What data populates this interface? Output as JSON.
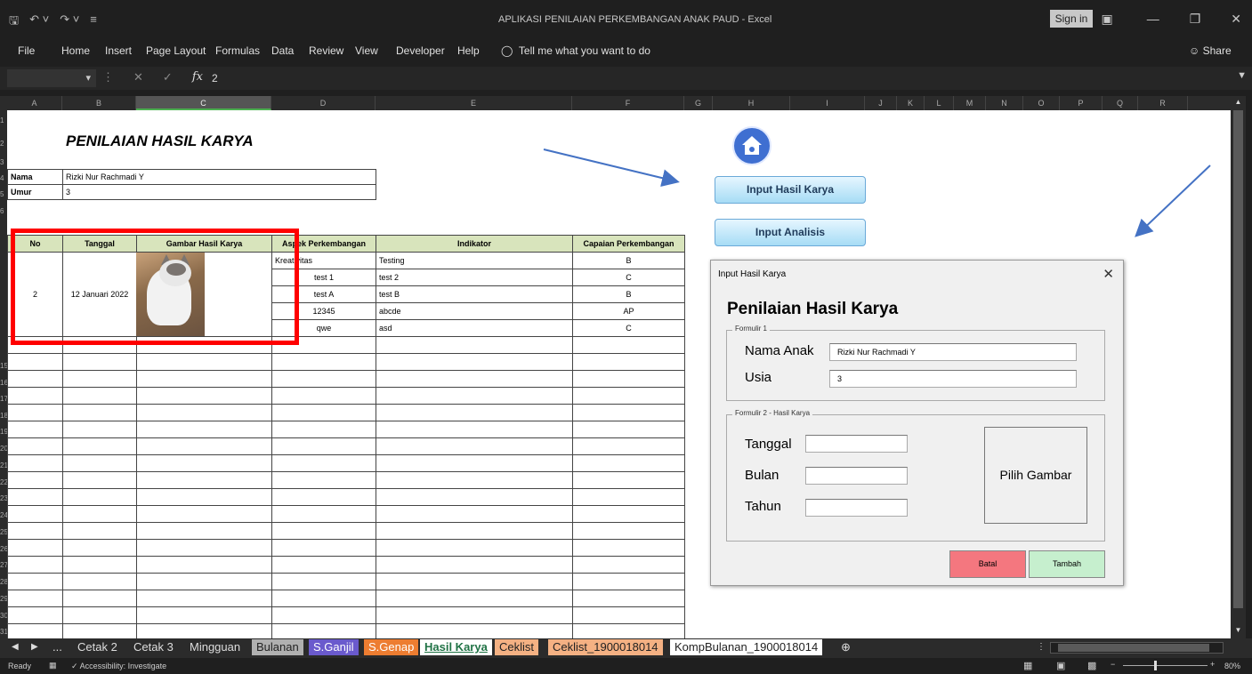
{
  "window": {
    "title": "APLIKASI PENILAIAN PERKEMBANGAN ANAK PAUD  -  Excel",
    "signin": "Sign in"
  },
  "ribbon": {
    "tabs": [
      "File",
      "Home",
      "Insert",
      "Page Layout",
      "Formulas",
      "Data",
      "Review",
      "View",
      "Developer",
      "Help"
    ],
    "tell_me": "Tell me what you want to do",
    "share": "Share"
  },
  "formula_bar": {
    "value": "2"
  },
  "columns": [
    "A",
    "B",
    "C",
    "D",
    "E",
    "F",
    "G",
    "H",
    "I",
    "J",
    "K",
    "L",
    "M",
    "N",
    "O",
    "P",
    "Q",
    "R"
  ],
  "rows": [
    "1",
    "2",
    "3",
    "4",
    "5",
    "6",
    "",
    "",
    "",
    "",
    "",
    "",
    "",
    "",
    "15",
    "16",
    "17",
    "18",
    "19",
    "20",
    "21",
    "22",
    "23",
    "24",
    "25",
    "26",
    "27",
    "28",
    "29",
    "30",
    "31"
  ],
  "sheet": {
    "title": "PENILAIAN HASIL KARYA",
    "nama_label": "Nama",
    "nama_value": "Rizki Nur Rachmadi Y",
    "umur_label": "Umur",
    "umur_value": "3",
    "headers": [
      "No",
      "Tanggal",
      "Gambar Hasil Karya",
      "Aspek Perkembangan",
      "Indikator",
      "Capaian Perkembangan"
    ],
    "no": "2",
    "tanggal": "12 Januari 2022",
    "entries": [
      {
        "aspek": "Kreativitas",
        "indikator": "Testing",
        "capaian": "B"
      },
      {
        "aspek": "test 1",
        "indikator": "test 2",
        "capaian": "C"
      },
      {
        "aspek": "test A",
        "indikator": "test B",
        "capaian": "B"
      },
      {
        "aspek": "12345",
        "indikator": "abcde",
        "capaian": "AP"
      },
      {
        "aspek": "qwe",
        "indikator": "asd",
        "capaian": "C"
      }
    ]
  },
  "buttons": {
    "input_hasil_karya": "Input Hasil Karya",
    "input_analisis": "Input Analisis"
  },
  "dialog": {
    "title": "Input Hasil Karya",
    "heading": "Penilaian Hasil Karya",
    "group1": "Formulir 1",
    "nama_anak_label": "Nama Anak",
    "nama_anak_value": "Rizki Nur Rachmadi Y",
    "usia_label": "Usia",
    "usia_value": "3",
    "group2": "Formulir 2 - Hasil Karya",
    "tanggal_label": "Tanggal",
    "bulan_label": "Bulan",
    "tahun_label": "Tahun",
    "pilih_gambar": "Pilih Gambar",
    "batal": "Batal",
    "tambah": "Tambah",
    "batal_color": "#f4777f",
    "tambah_color": "#c6efce"
  },
  "sheet_tabs": [
    {
      "label": "Cetak 2",
      "color": ""
    },
    {
      "label": "Cetak 3",
      "color": ""
    },
    {
      "label": "Mingguan",
      "color": ""
    },
    {
      "label": "Bulanan",
      "color": "#b0b0b0"
    },
    {
      "label": "S.Ganjil",
      "color": "#6a5acd"
    },
    {
      "label": "S.Genap",
      "color": "#ed7d31"
    },
    {
      "label": "Hasil Karya",
      "color": "#ffffff",
      "active": true
    },
    {
      "label": "Ceklist",
      "color": "#f4b183"
    },
    {
      "label": "Ceklist_1900018014",
      "color": "#f4b183"
    },
    {
      "label": "KompBulanan_1900018014",
      "color": "#ffffff"
    }
  ],
  "status": {
    "ready": "Ready",
    "accessibility": "Accessibility: Investigate",
    "zoom": "80%"
  }
}
